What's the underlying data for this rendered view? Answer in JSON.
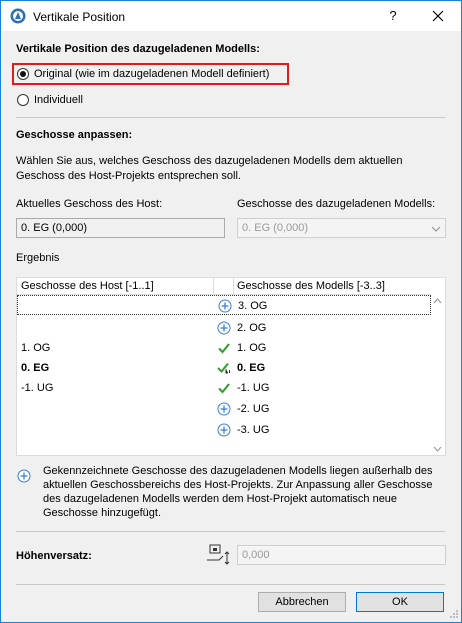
{
  "window": {
    "title": "Vertikale Position",
    "help_glyph": "?",
    "close_glyph": "✕"
  },
  "vertical_position": {
    "heading": "Vertikale Position des dazugeladenen Modells:",
    "options": [
      {
        "label": "Original (wie im dazugeladenen Modell definiert)",
        "selected": true
      },
      {
        "label": "Individuell",
        "selected": false
      }
    ]
  },
  "adjust_stories": {
    "heading": "Geschosse anpassen:",
    "description": "Wählen Sie aus, welches Geschoss des dazugeladenen Modells dem aktuellen Geschoss des Host-Projekts entsprechen soll.",
    "host_label": "Aktuelles Geschoss des Host:",
    "host_value": "0. EG (0,000)",
    "model_label": "Geschosse des dazugeladenen Modells:",
    "model_value": "0. EG (0,000)"
  },
  "result": {
    "heading": "Ergebnis",
    "col_host": "Geschosse des Host [-1..1]",
    "col_model": "Geschosse des Modells [-3..3]",
    "rows": [
      {
        "host": "",
        "icon": "plus-icon",
        "model": "3. OG",
        "bold": false,
        "selected": true
      },
      {
        "host": "",
        "icon": "plus-icon",
        "model": "2. OG",
        "bold": false,
        "selected": false
      },
      {
        "host": "1. OG",
        "icon": "check-icon",
        "model": "1. OG",
        "bold": false,
        "selected": false
      },
      {
        "host": "0. EG",
        "icon": "check-link-icon",
        "model": "0. EG",
        "bold": true,
        "selected": false
      },
      {
        "host": "-1. UG",
        "icon": "check-icon",
        "model": "-1. UG",
        "bold": false,
        "selected": false
      },
      {
        "host": "",
        "icon": "plus-icon",
        "model": "-2. UG",
        "bold": false,
        "selected": false
      },
      {
        "host": "",
        "icon": "plus-icon",
        "model": "-3. UG",
        "bold": false,
        "selected": false
      }
    ]
  },
  "note": {
    "text": "Gekennzeichnete Geschosse des dazugeladenen Modells liegen außerhalb des aktuellen Geschossbereichs des Host-Projekts. Zur Anpassung aller Geschosse des dazugeladenen Modells werden dem Host-Projekt automatisch neue Geschosse hinzugefügt."
  },
  "offset": {
    "label": "Höhenversatz:",
    "value": "0,000"
  },
  "buttons": {
    "cancel": "Abbrechen",
    "ok": "OK"
  },
  "colors": {
    "highlight": "#e31a1a",
    "accent": "#0078d7",
    "check": "#2e9e2e",
    "plus": "#3a7fd5"
  }
}
